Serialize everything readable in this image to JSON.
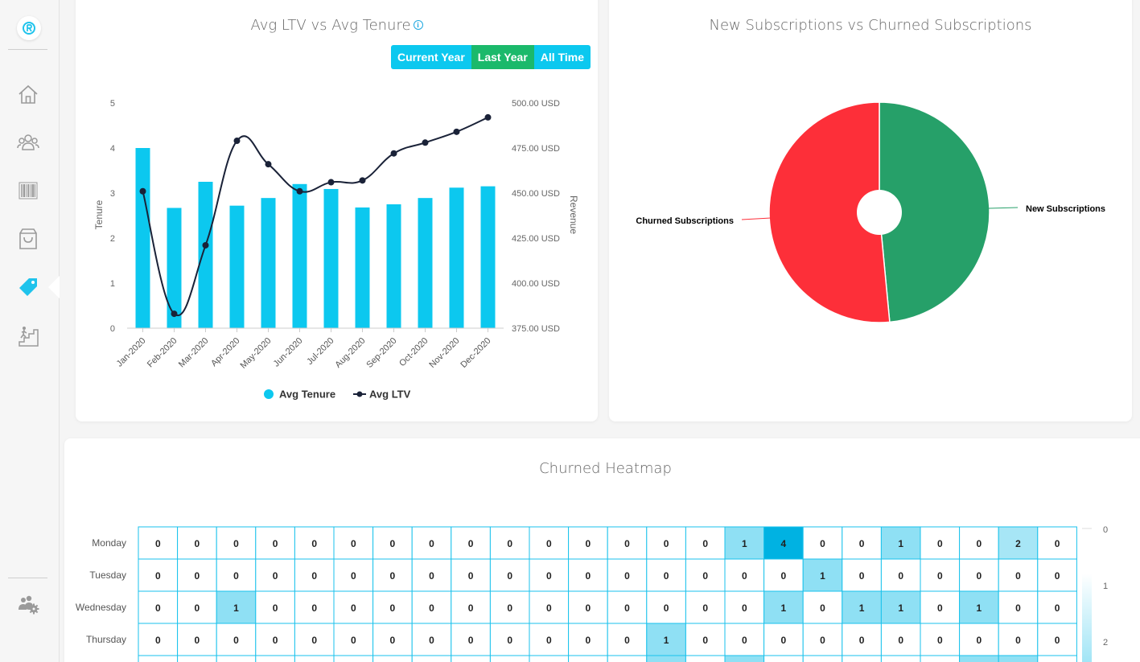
{
  "sidebar": {
    "items": [
      {
        "name": "home-icon",
        "active": false
      },
      {
        "name": "customers-icon",
        "active": false
      },
      {
        "name": "barcode-icon",
        "active": false
      },
      {
        "name": "shopping-bag-icon",
        "active": false
      },
      {
        "name": "tag-icon",
        "active": true
      },
      {
        "name": "stairs-climber-icon",
        "active": false
      }
    ],
    "bottom_icon": "team-settings-icon"
  },
  "colors": {
    "accent": "#0cc8ef",
    "active_button": "#1bb96b",
    "line": "#1a2238",
    "churned": "#fd2f39",
    "new": "#26a069"
  },
  "ltv_chart": {
    "title": "Avg LTV vs Avg Tenure",
    "buttons": [
      {
        "label": "Current Year",
        "active": false
      },
      {
        "label": "Last Year",
        "active": true
      },
      {
        "label": "All Time",
        "active": false
      }
    ]
  },
  "pie_chart": {
    "title": "New Subscriptions vs Churned Subscriptions"
  },
  "heatmap": {
    "title": "Churned Heatmap",
    "rows": [
      "Monday",
      "Tuesday",
      "Wednesday",
      "Thursday"
    ],
    "values": [
      [
        0,
        0,
        0,
        0,
        0,
        0,
        0,
        0,
        0,
        0,
        0,
        0,
        0,
        0,
        0,
        1,
        4,
        0,
        0,
        1,
        0,
        0,
        2,
        0
      ],
      [
        0,
        0,
        0,
        0,
        0,
        0,
        0,
        0,
        0,
        0,
        0,
        0,
        0,
        0,
        0,
        0,
        0,
        1,
        0,
        0,
        0,
        0,
        0,
        0
      ],
      [
        0,
        0,
        1,
        0,
        0,
        0,
        0,
        0,
        0,
        0,
        0,
        0,
        0,
        0,
        0,
        0,
        1,
        0,
        1,
        1,
        0,
        1,
        0,
        0
      ],
      [
        0,
        0,
        0,
        0,
        0,
        0,
        0,
        0,
        0,
        0,
        0,
        0,
        0,
        1,
        0,
        0,
        0,
        0,
        0,
        0,
        0,
        0,
        0,
        0
      ]
    ],
    "scale_labels": [
      "0",
      "1",
      "2"
    ]
  },
  "chart_data": [
    {
      "type": "bar",
      "title": "Avg LTV vs Avg Tenure",
      "categories": [
        "Jan-2020",
        "Feb-2020",
        "Mar-2020",
        "Apr-2020",
        "May-2020",
        "Jun-2020",
        "Jul-2020",
        "Aug-2020",
        "Sep-2020",
        "Oct-2020",
        "Nov-2020",
        "Dec-2020"
      ],
      "series": [
        {
          "name": "Avg Tenure",
          "type": "bar",
          "axis": "left",
          "values": [
            4.0,
            2.67,
            3.25,
            2.72,
            2.89,
            3.2,
            3.09,
            2.68,
            2.75,
            2.89,
            3.12,
            3.15
          ]
        },
        {
          "name": "Avg LTV",
          "type": "line",
          "axis": "right",
          "values": [
            451,
            383,
            421,
            479,
            466,
            451,
            456,
            457,
            472,
            478,
            484,
            492
          ]
        }
      ],
      "ylabel": "Tenure",
      "y2label": "Revenue",
      "ylim": [
        0,
        5
      ],
      "y2lim": [
        375,
        500
      ],
      "yticks": [
        "0",
        "1",
        "2",
        "3",
        "4",
        "5"
      ],
      "y2ticks": [
        "375.00 USD",
        "400.00 USD",
        "425.00 USD",
        "450.00 USD",
        "475.00 USD",
        "500.00 USD"
      ],
      "legend": "bottom"
    },
    {
      "type": "pie",
      "title": "New Subscriptions vs Churned Subscriptions",
      "labels": [
        "New Subscriptions",
        "Churned Subscriptions"
      ],
      "values": [
        48.5,
        51.5
      ]
    },
    {
      "type": "heatmap",
      "title": "Churned Heatmap",
      "rows": [
        "Monday",
        "Tuesday",
        "Wednesday",
        "Thursday"
      ],
      "value_range": [
        0,
        2
      ]
    }
  ]
}
